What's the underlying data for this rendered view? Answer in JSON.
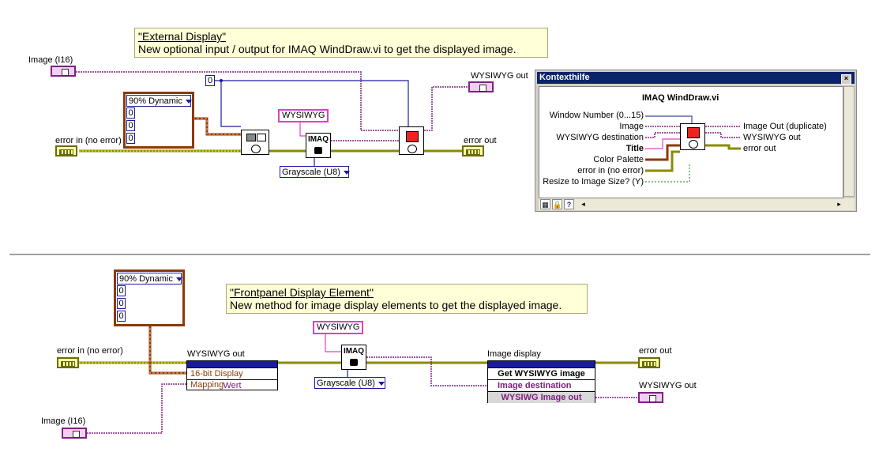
{
  "top": {
    "note_title": "\"External Display\"",
    "note_text": "New optional input / output for IMAQ WindDraw.vi to get the displayed image.",
    "image_label": "Image (I16)",
    "error_in_label": "error in (no error)",
    "error_out_label": "error out",
    "wysiwyg_out_label": "WYSIWYG out",
    "palette_mode": "90% Dynamic",
    "palette_values": [
      "0",
      "0",
      "0"
    ],
    "const_zero": "0",
    "wysiwyg_string": "WYSIWYG",
    "imaq_label": "IMAQ",
    "grayscale": "Grayscale (U8)"
  },
  "help": {
    "window_title": "Kontexthilfe",
    "close": "×",
    "vi_name": "IMAQ WindDraw.vi",
    "inputs": [
      "Window Number (0...15)",
      "Image",
      "WYSIWYG destination",
      "Title",
      "Color Palette",
      "error in (no error)",
      "Resize to Image Size? (Y)"
    ],
    "outputs": [
      "Image Out (duplicate)",
      "WYSIWYG out",
      "error out"
    ],
    "btn_help": "?"
  },
  "bottom": {
    "note_title": "\"Frontpanel Display Element\"",
    "note_text": "New method for image display elements to get the displayed image.",
    "palette_mode": "90% Dynamic",
    "palette_values": [
      "0",
      "0",
      "0"
    ],
    "error_in_label": "error in (no error)",
    "image_label": "Image (I16)",
    "prop_title": "WYSIWYG out",
    "prop_rows": [
      "16-bit Display Mapping",
      "Wert"
    ],
    "wysiwyg_string": "WYSIWYG",
    "imaq_label": "IMAQ",
    "grayscale": "Grayscale (U8)",
    "display_title": "Image display",
    "display_rows": [
      "Get WYSIWYG image",
      "Image destination",
      "WYSIWG Image out"
    ],
    "error_out_label": "error out",
    "wysiwyg_out_label": "WYSIWYG out"
  },
  "colors": {
    "error_wire": "#8b8b00",
    "image_wire": "#802080",
    "int_wire": "#1a1aa0",
    "palette_wire": "#8b3a0a",
    "string_wire": "#e040c0"
  }
}
